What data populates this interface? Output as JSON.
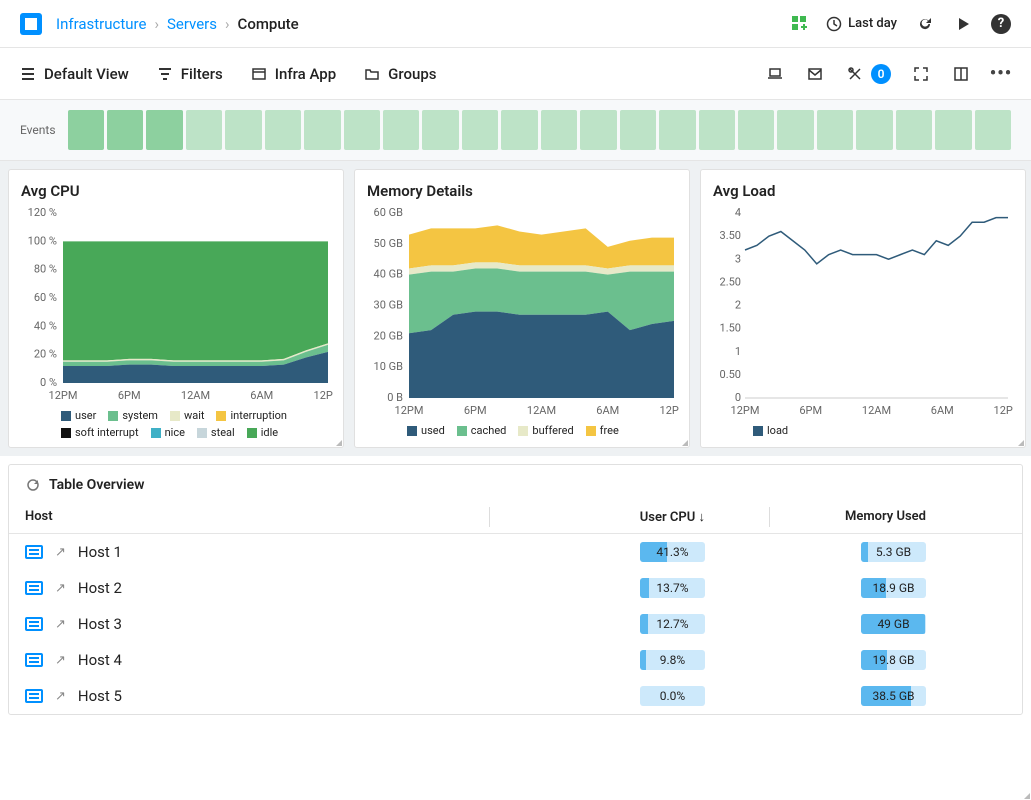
{
  "breadcrumb": {
    "root": "Infrastructure",
    "mid": "Servers",
    "current": "Compute"
  },
  "topbar": {
    "time_range": "Last day",
    "alert_count": "0"
  },
  "toolbar": {
    "default_view": "Default View",
    "filters": "Filters",
    "infra_app": "Infra App",
    "groups": "Groups"
  },
  "events_label": "Events",
  "cards": {
    "avg_cpu": {
      "title": "Avg CPU"
    },
    "memory": {
      "title": "Memory Details"
    },
    "avg_load": {
      "title": "Avg Load"
    }
  },
  "legends": {
    "cpu": [
      "user",
      "system",
      "wait",
      "interruption",
      "soft interrupt",
      "nice",
      "steal",
      "idle"
    ],
    "mem": [
      "used",
      "cached",
      "buffered",
      "free"
    ],
    "load": [
      "load"
    ]
  },
  "legend_colors": {
    "cpu": [
      "#2f5b7a",
      "#6bbf8e",
      "#e7e9c8",
      "#f4c542",
      "#111",
      "#3fb0c6",
      "#c7d6db",
      "#48a858"
    ],
    "mem": [
      "#2f5b7a",
      "#6bbf8e",
      "#e7e9c8",
      "#f4c542"
    ],
    "load": [
      "#2f5b7a"
    ]
  },
  "table": {
    "title": "Table Overview",
    "columns": {
      "host": "Host",
      "cpu": "User CPU ↓",
      "mem": "Memory Used"
    },
    "rows": [
      {
        "host": "Host 1",
        "cpu": "41.3%",
        "cpu_pct": 41.3,
        "mem": "5.3 GB",
        "mem_pct": 11
      },
      {
        "host": "Host 2",
        "cpu": "13.7%",
        "cpu_pct": 13.7,
        "mem": "18.9 GB",
        "mem_pct": 38
      },
      {
        "host": "Host 3",
        "cpu": "12.7%",
        "cpu_pct": 12.7,
        "mem": "49 GB",
        "mem_pct": 98
      },
      {
        "host": "Host 4",
        "cpu": "9.8%",
        "cpu_pct": 9.8,
        "mem": "19.8 GB",
        "mem_pct": 40
      },
      {
        "host": "Host 5",
        "cpu": "0.0%",
        "cpu_pct": 0,
        "mem": "38.5 GB",
        "mem_pct": 77
      }
    ]
  },
  "chart_data": [
    {
      "type": "area",
      "title": "Avg CPU",
      "xlabel": "",
      "ylabel": "",
      "x_ticks": [
        "12PM",
        "6PM",
        "12AM",
        "6AM",
        "12PM"
      ],
      "y_ticks": [
        "0 %",
        "20 %",
        "40 %",
        "60 %",
        "80 %",
        "100 %",
        "120 %"
      ],
      "ylim": [
        0,
        120
      ],
      "series": [
        {
          "name": "user",
          "values": [
            12,
            12,
            12,
            13,
            13,
            12,
            12,
            12,
            12,
            12,
            13,
            18,
            22
          ]
        },
        {
          "name": "system",
          "values": [
            3,
            3,
            3,
            3,
            3,
            3,
            3,
            3,
            3,
            3,
            3,
            4,
            5
          ]
        },
        {
          "name": "wait",
          "values": [
            1,
            1,
            1,
            1,
            1,
            1,
            1,
            1,
            1,
            1,
            1,
            1,
            1
          ]
        },
        {
          "name": "interruption",
          "values": [
            0,
            0,
            0,
            0,
            0,
            0,
            0,
            0,
            0,
            0,
            0,
            0,
            0
          ]
        },
        {
          "name": "soft interrupt",
          "values": [
            0,
            0,
            0,
            0,
            0,
            0,
            0,
            0,
            0,
            0,
            0,
            0,
            0
          ]
        },
        {
          "name": "nice",
          "values": [
            0,
            0,
            0,
            0,
            0,
            0,
            0,
            0,
            0,
            0,
            0,
            0,
            0
          ]
        },
        {
          "name": "steal",
          "values": [
            0,
            0,
            0,
            0,
            0,
            0,
            0,
            0,
            0,
            0,
            0,
            0,
            0
          ]
        },
        {
          "name": "idle",
          "values": [
            84,
            84,
            84,
            83,
            83,
            84,
            84,
            84,
            84,
            84,
            83,
            77,
            72
          ]
        }
      ]
    },
    {
      "type": "area",
      "title": "Memory Details",
      "xlabel": "",
      "ylabel": "",
      "x_ticks": [
        "12PM",
        "6PM",
        "12AM",
        "6AM",
        "12PM"
      ],
      "y_ticks": [
        "0 B",
        "10 GB",
        "20 GB",
        "30 GB",
        "40 GB",
        "50 GB",
        "60 GB"
      ],
      "ylim": [
        0,
        60
      ],
      "series": [
        {
          "name": "used",
          "values": [
            21,
            22,
            27,
            28,
            28,
            27,
            27,
            27,
            27,
            28,
            22,
            24,
            25
          ]
        },
        {
          "name": "cached",
          "values": [
            19,
            19,
            14,
            14,
            14,
            14,
            14,
            14,
            14,
            12,
            19,
            17,
            16
          ]
        },
        {
          "name": "buffered",
          "values": [
            2,
            2,
            2,
            2,
            2,
            2,
            2,
            2,
            2,
            2,
            2,
            2,
            2
          ]
        },
        {
          "name": "free",
          "values": [
            11,
            12,
            12,
            11,
            12,
            11,
            10,
            11,
            12,
            7,
            8,
            9,
            9
          ]
        }
      ]
    },
    {
      "type": "line",
      "title": "Avg Load",
      "xlabel": "",
      "ylabel": "",
      "x_ticks": [
        "12PM",
        "6PM",
        "12AM",
        "6AM",
        "12PM"
      ],
      "y_ticks": [
        "0",
        "0.50",
        "1",
        "1.50",
        "2",
        "2.50",
        "3",
        "3.50",
        "4"
      ],
      "ylim": [
        0,
        4
      ],
      "series": [
        {
          "name": "load",
          "values": [
            3.2,
            3.3,
            3.5,
            3.6,
            3.4,
            3.2,
            2.9,
            3.1,
            3.2,
            3.1,
            3.1,
            3.1,
            3.0,
            3.1,
            3.2,
            3.1,
            3.4,
            3.3,
            3.5,
            3.8,
            3.8,
            3.9,
            3.9
          ]
        }
      ]
    }
  ]
}
